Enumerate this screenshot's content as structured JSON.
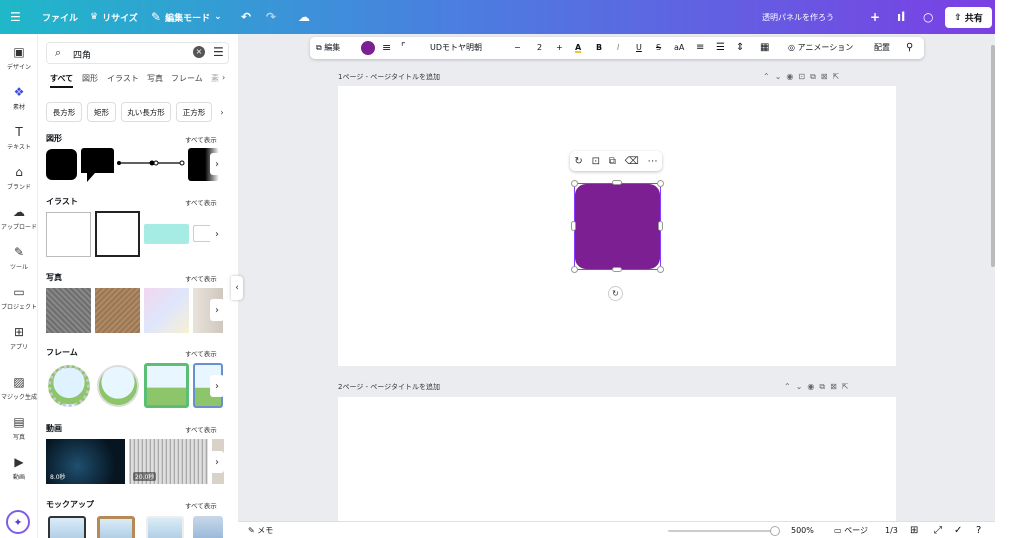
{
  "topbar": {
    "menu_icon": "hamburger-icon",
    "file": "ファイル",
    "resize": "リサイズ",
    "edit_mode": "編集モード",
    "title": "透明パネルを作ろう",
    "share": "共有",
    "colors": {
      "start": "#1fb8c9",
      "mid": "#4a7fe0",
      "end": "#7b3fe4"
    }
  },
  "rail": {
    "items": [
      {
        "label": "デザイン",
        "icon": "layout-icon"
      },
      {
        "label": "素材",
        "icon": "elements-icon"
      },
      {
        "label": "テキスト",
        "icon": "text-icon"
      },
      {
        "label": "ブランド",
        "icon": "brand-icon"
      },
      {
        "label": "アップロード",
        "icon": "upload-icon"
      },
      {
        "label": "ツール",
        "icon": "tools-icon"
      },
      {
        "label": "プロジェクト",
        "icon": "folder-icon"
      },
      {
        "label": "アプリ",
        "icon": "apps-icon"
      },
      {
        "label": "マジック生成",
        "icon": "magic-media-icon"
      },
      {
        "label": "写真",
        "icon": "photo-icon"
      },
      {
        "label": "動画",
        "icon": "video-icon"
      }
    ]
  },
  "panel": {
    "search_value": "四角",
    "tabs": [
      "すべて",
      "図形",
      "イラスト",
      "写真",
      "フレーム",
      "素"
    ],
    "chips": [
      "長方形",
      "矩形",
      "丸い長方形",
      "正方形"
    ],
    "see_all": "すべて表示",
    "sections": [
      "図形",
      "イラスト",
      "写真",
      "フレーム",
      "動画",
      "モックアップ"
    ],
    "video_durations": [
      "8.0秒",
      "20.0秒"
    ]
  },
  "toolbar": {
    "edit": "編集",
    "font": "UDモトヤ明朝",
    "font_size": "2",
    "animation": "アニメーション",
    "position": "配置",
    "shape_color": "#7b1f92"
  },
  "pages": {
    "page1_label": "1ページ - ページタイトルを追加",
    "page2_label": "2ページ - ページタイトルを追加"
  },
  "bottombar": {
    "notes": "メモ",
    "zoom": "500%",
    "pages_label": "ページ",
    "page_count": "1/3"
  }
}
